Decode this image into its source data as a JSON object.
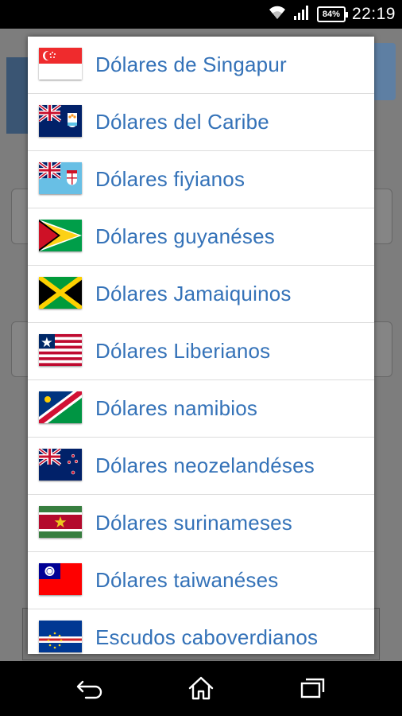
{
  "status_bar": {
    "battery_level": "84%",
    "time": "22:19"
  },
  "dialog": {
    "items": [
      {
        "label": "Dólares de Singapur",
        "flag": "singapore-flag-icon"
      },
      {
        "label": "Dólares del Caribe",
        "flag": "anguilla-flag-icon"
      },
      {
        "label": "Dólares fiyianos",
        "flag": "fiji-flag-icon"
      },
      {
        "label": "Dólares guyanéses",
        "flag": "guyana-flag-icon"
      },
      {
        "label": "Dólares Jamaiquinos",
        "flag": "jamaica-flag-icon"
      },
      {
        "label": "Dólares Liberianos",
        "flag": "liberia-flag-icon"
      },
      {
        "label": "Dólares namibios",
        "flag": "namibia-flag-icon"
      },
      {
        "label": "Dólares neozelandéses",
        "flag": "new-zealand-flag-icon"
      },
      {
        "label": "Dólares surinameses",
        "flag": "suriname-flag-icon"
      },
      {
        "label": "Dólares taiwanéses",
        "flag": "taiwan-flag-icon"
      },
      {
        "label": "Escudos caboverdianos",
        "flag": "cape-verde-flag-icon"
      }
    ]
  },
  "nav_bar": {
    "buttons": [
      "back-icon",
      "home-icon",
      "recent-apps-icon"
    ]
  },
  "colors": {
    "label_text": "#3472b8",
    "divider": "#dcdcdc",
    "dim_background": "#7d7d7d"
  }
}
